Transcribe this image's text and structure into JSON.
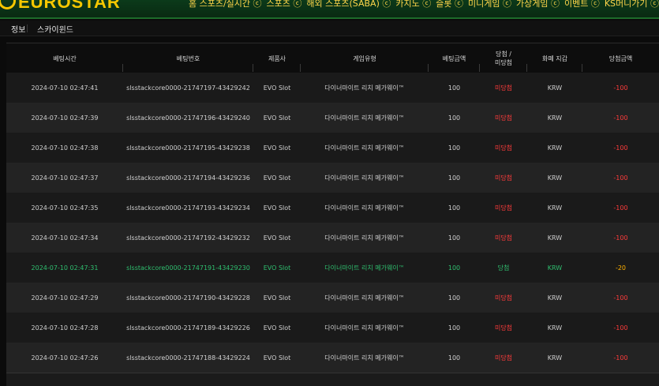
{
  "header": {
    "logo_text": "EUROSTAR",
    "nav": [
      "홈 스포츠/실시간 ⓒ",
      "스포츠 ⓒ",
      "해외 스포츠(SABA) ⓒ",
      "카지노 ⓒ",
      "슬롯 ⓒ",
      "미니게임 ⓒ",
      "가상게임 ⓒ",
      "이벤트 ⓒ",
      "KS머니가기 ⓒ"
    ]
  },
  "tabs": {
    "info": "정보",
    "skywind": "스카이윈드"
  },
  "table": {
    "columns": [
      "베팅시간",
      "베팅번호",
      "제품사",
      "게임유형",
      "베팅금액",
      "당첨 /\n미당첨",
      "화폐 지갑",
      "당첨금액"
    ],
    "rows": [
      {
        "time": "2024-07-10 02:47:41",
        "bet_no": "slsstackcore0000-21747197-43429242",
        "provider": "EVO Slot",
        "game": "다이너마이트 리치 메가웨이™",
        "amount": "100",
        "result": "미당첨",
        "currency": "KRW",
        "win": "-100"
      },
      {
        "time": "2024-07-10 02:47:39",
        "bet_no": "slsstackcore0000-21747196-43429240",
        "provider": "EVO Slot",
        "game": "다이너마이트 리치 메가웨이™",
        "amount": "100",
        "result": "미당첨",
        "currency": "KRW",
        "win": "-100"
      },
      {
        "time": "2024-07-10 02:47:38",
        "bet_no": "slsstackcore0000-21747195-43429238",
        "provider": "EVO Slot",
        "game": "다이너마이트 리치 메가웨이™",
        "amount": "100",
        "result": "미당첨",
        "currency": "KRW",
        "win": "-100"
      },
      {
        "time": "2024-07-10 02:47:37",
        "bet_no": "slsstackcore0000-21747194-43429236",
        "provider": "EVO Slot",
        "game": "다이너마이트 리치 메가웨이™",
        "amount": "100",
        "result": "미당첨",
        "currency": "KRW",
        "win": "-100"
      },
      {
        "time": "2024-07-10 02:47:35",
        "bet_no": "slsstackcore0000-21747193-43429234",
        "provider": "EVO Slot",
        "game": "다이너마이트 리치 메가웨이™",
        "amount": "100",
        "result": "미당첨",
        "currency": "KRW",
        "win": "-100"
      },
      {
        "time": "2024-07-10 02:47:34",
        "bet_no": "slsstackcore0000-21747192-43429232",
        "provider": "EVO Slot",
        "game": "다이너마이트 리치 메가웨이™",
        "amount": "100",
        "result": "미당첨",
        "currency": "KRW",
        "win": "-100"
      },
      {
        "time": "2024-07-10 02:47:31",
        "bet_no": "slsstackcore0000-21747191-43429230",
        "provider": "EVO Slot",
        "game": "다이너마이트 리치 메가웨이™",
        "amount": "100",
        "result": "당첨",
        "currency": "KRW",
        "win": "-20"
      },
      {
        "time": "2024-07-10 02:47:29",
        "bet_no": "slsstackcore0000-21747190-43429228",
        "provider": "EVO Slot",
        "game": "다이너마이트 리치 메가웨이™",
        "amount": "100",
        "result": "미당첨",
        "currency": "KRW",
        "win": "-100"
      },
      {
        "time": "2024-07-10 02:47:28",
        "bet_no": "slsstackcore0000-21747189-43429226",
        "provider": "EVO Slot",
        "game": "다이너마이트 리치 메가웨이™",
        "amount": "100",
        "result": "미당첨",
        "currency": "KRW",
        "win": "-100"
      },
      {
        "time": "2024-07-10 02:47:26",
        "bet_no": "slsstackcore0000-21747188-43429224",
        "provider": "EVO Slot",
        "game": "다이너마이트 리치 메가웨이™",
        "amount": "100",
        "result": "미당첨",
        "currency": "KRW",
        "win": "-100"
      }
    ]
  },
  "colors": {
    "lose_red": "#ff3b3b",
    "win_green": "#2fbf6f",
    "brand_yellow": "#f6c700",
    "header_green": "#0b3a1a"
  }
}
